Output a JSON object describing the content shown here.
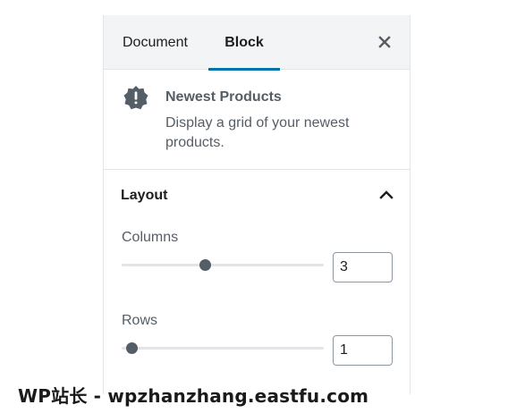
{
  "tabs": [
    {
      "label": "Document",
      "active": false
    },
    {
      "label": "Block",
      "active": true
    }
  ],
  "icons": {
    "close": "close-icon",
    "block": "alert-badge-icon",
    "collapse": "chevron-up-icon"
  },
  "block": {
    "name": "Newest Products",
    "description": "Display a grid of your newest products."
  },
  "layout": {
    "title": "Layout",
    "expanded": true,
    "columns": {
      "label": "Columns",
      "value": "3",
      "min": 1,
      "max": 6,
      "slider_fraction": 0.4
    },
    "rows": {
      "label": "Rows",
      "value": "1",
      "min": 1,
      "max": 6,
      "slider_fraction": 0.0
    }
  },
  "colors": {
    "accent": "#0073aa",
    "text": "#1e1e1e",
    "muted": "#555d66",
    "border": "#e2e4e7",
    "tab_bg": "#f3f4f5"
  },
  "watermark": "WP站长 - wpzhanzhang.eastfu.com"
}
